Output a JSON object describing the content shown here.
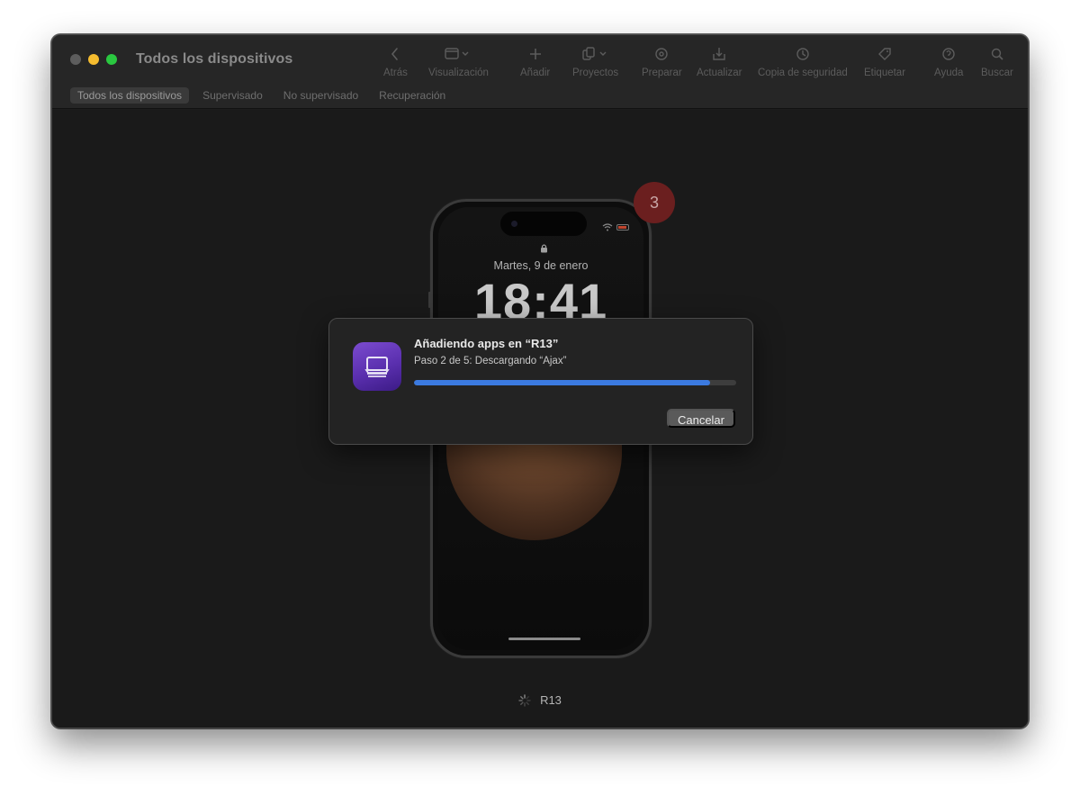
{
  "window": {
    "title": "Todos los dispositivos"
  },
  "toolbar": {
    "items": [
      {
        "label": "Atrás",
        "icon": "chevron-left-icon"
      },
      {
        "label": "Visualización",
        "icon": "view-icon"
      },
      {
        "label": "Añadir",
        "icon": "plus-icon"
      },
      {
        "label": "Proyectos",
        "icon": "blueprint-icon"
      },
      {
        "label": "Preparar",
        "icon": "gear-icon"
      },
      {
        "label": "Actualizar",
        "icon": "update-icon"
      },
      {
        "label": "Copia de seguridad",
        "icon": "backup-icon"
      },
      {
        "label": "Etiquetar",
        "icon": "tag-icon"
      },
      {
        "label": "Ayuda",
        "icon": "help-icon"
      },
      {
        "label": "Buscar",
        "icon": "search-icon"
      }
    ]
  },
  "scope": {
    "tabs": [
      {
        "label": "Todos los dispositivos",
        "active": true
      },
      {
        "label": "Supervisado",
        "active": false
      },
      {
        "label": "No supervisado",
        "active": false
      },
      {
        "label": "Recuperación",
        "active": false
      }
    ]
  },
  "phone": {
    "date": "Martes, 9 de enero",
    "time": "18:41"
  },
  "badge": {
    "number": "3"
  },
  "dialog": {
    "title": "Añadiendo apps en “R13”",
    "subtitle": "Paso 2 de 5: Descargando “Ajax”",
    "progress": 0.92,
    "cancel_label": "Cancelar"
  },
  "device": {
    "name": "R13"
  },
  "colors": {
    "accent": "#3b7ae0",
    "badge": "#6b1f1f",
    "app_icon": "#5a2fae"
  }
}
